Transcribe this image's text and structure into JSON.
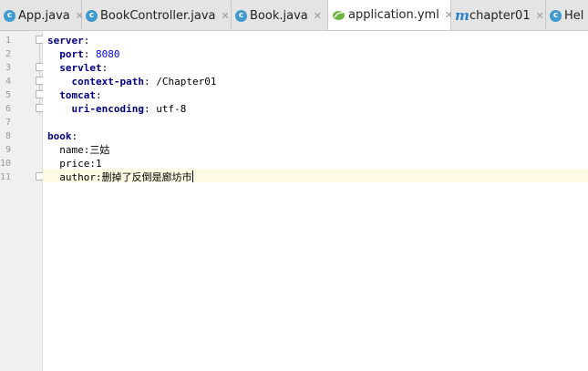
{
  "tabs": [
    {
      "label": "App.java",
      "icon": "java-class-icon",
      "active": false
    },
    {
      "label": "BookController.java",
      "icon": "java-class-icon",
      "active": false
    },
    {
      "label": "Book.java",
      "icon": "java-class-icon",
      "active": false
    },
    {
      "label": "application.yml",
      "icon": "yaml-spring-icon",
      "active": true
    },
    {
      "label": "chapter01",
      "icon": "maven-module-icon",
      "active": false
    },
    {
      "label": "Hel",
      "icon": "java-class-icon",
      "active": false
    }
  ],
  "class_icon_letter": "c",
  "module_icon_letter": "m",
  "close_glyph": "✕",
  "line_numbers": [
    "1",
    "2",
    "3",
    "4",
    "5",
    "6",
    "7",
    "8",
    "9",
    "10",
    "11"
  ],
  "code": {
    "l1_key": "server",
    "l2_key": "port",
    "l2_value": "8080",
    "l3_key": "servlet",
    "l4_key": "context-path",
    "l4_value": "/Chapter01",
    "l5_key": "tomcat",
    "l6_key": "uri-encoding",
    "l6_value": "utf-8",
    "l8_key": "book",
    "l9_text": "name:三姑",
    "l10_text": "price:1",
    "l11_text": "author:删掉了反倒是廊坊市"
  },
  "colors": {
    "key": "#000080",
    "number": "#0000ff",
    "current_line": "#fffae3"
  }
}
